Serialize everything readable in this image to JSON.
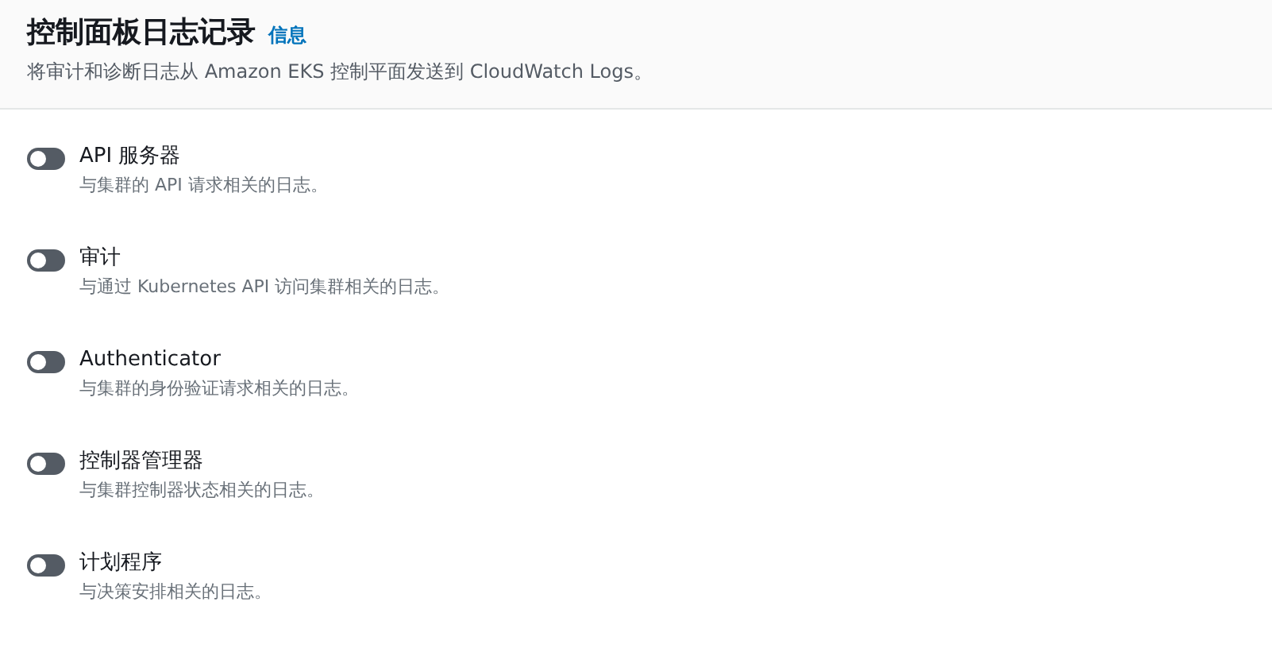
{
  "header": {
    "title": "控制面板日志记录",
    "info_link": "信息",
    "description": "将审计和诊断日志从 Amazon EKS 控制平面发送到 CloudWatch Logs。"
  },
  "log_types": [
    {
      "label": "API 服务器",
      "description": "与集群的 API 请求相关的日志。",
      "on": false
    },
    {
      "label": "审计",
      "description": "与通过 Kubernetes API 访问集群相关的日志。",
      "on": false
    },
    {
      "label": "Authenticator",
      "description": "与集群的身份验证请求相关的日志。",
      "on": false
    },
    {
      "label": "控制器管理器",
      "description": "与集群控制器状态相关的日志。",
      "on": false
    },
    {
      "label": "计划程序",
      "description": "与决策安排相关的日志。",
      "on": false
    }
  ]
}
